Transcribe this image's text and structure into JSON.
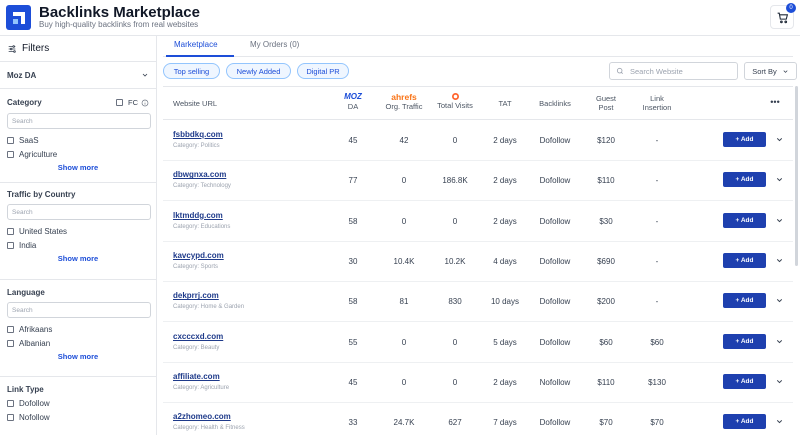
{
  "header": {
    "title": "Backlinks Marketplace",
    "subtitle": "Buy high-quality backlinks from real websites",
    "cart_count": "0"
  },
  "sidebar": {
    "title": "Filters",
    "moz_da": "Moz DA",
    "category": {
      "title": "Category",
      "fc_label": "FC",
      "search_placeholder": "Search",
      "options": [
        "SaaS",
        "Agriculture"
      ],
      "show_more": "Show more"
    },
    "traffic": {
      "title": "Traffic by Country",
      "search_placeholder": "Search",
      "options": [
        "United States",
        "India"
      ],
      "show_more": "Show more"
    },
    "language": {
      "title": "Language",
      "search_placeholder": "Search",
      "options": [
        "Afrikaans",
        "Albanian"
      ],
      "show_more": "Show more"
    },
    "link_type": {
      "title": "Link Type",
      "options": [
        "Dofollow",
        "Nofollow"
      ]
    }
  },
  "tabs": {
    "marketplace": "Marketplace",
    "orders": "My Orders (0)"
  },
  "chips": [
    "Top selling",
    "Newly Added",
    "Digital PR"
  ],
  "search_placeholder": "Search Website",
  "sort_label": "Sort By",
  "columns": {
    "website_url": "Website URL",
    "moz_logo": "MOZ",
    "da": "DA",
    "ahrefs_logo": "ahrefs",
    "org_traffic": "Org. Traffic",
    "total_visits": "Total Visits",
    "tat": "TAT",
    "backlinks": "Backlinks",
    "guest_post": "Guest Post",
    "link_insertion": "Link Insertion",
    "more": "•••"
  },
  "add_label": "+ Add",
  "rows": [
    {
      "site": "fsbbdkq.com",
      "category": "Category: Politics",
      "da": "45",
      "traffic": "42",
      "visits": "0",
      "tat": "2 days",
      "backlinks": "Dofollow",
      "guest": "$120",
      "insertion": "-"
    },
    {
      "site": "dbwgnxa.com",
      "category": "Category: Technology",
      "da": "77",
      "traffic": "0",
      "visits": "186.8K",
      "tat": "2 days",
      "backlinks": "Dofollow",
      "guest": "$110",
      "insertion": "-"
    },
    {
      "site": "lktmddg.com",
      "category": "Category: Educations",
      "da": "58",
      "traffic": "0",
      "visits": "0",
      "tat": "2 days",
      "backlinks": "Dofollow",
      "guest": "$30",
      "insertion": "-"
    },
    {
      "site": "kavcypd.com",
      "category": "Category: Sports",
      "da": "30",
      "traffic": "10.4K",
      "visits": "10.2K",
      "tat": "4 days",
      "backlinks": "Dofollow",
      "guest": "$690",
      "insertion": "-"
    },
    {
      "site": "dekprrj.com",
      "category": "Category: Home & Garden",
      "da": "58",
      "traffic": "81",
      "visits": "830",
      "tat": "10 days",
      "backlinks": "Dofollow",
      "guest": "$200",
      "insertion": "-"
    },
    {
      "site": "cxcccxd.com",
      "category": "Category: Beauty",
      "da": "55",
      "traffic": "0",
      "visits": "0",
      "tat": "5 days",
      "backlinks": "Dofollow",
      "guest": "$60",
      "insertion": "$60"
    },
    {
      "site": "affiliate.com",
      "category": "Category: Agriculture",
      "da": "45",
      "traffic": "0",
      "visits": "0",
      "tat": "2 days",
      "backlinks": "Nofollow",
      "guest": "$110",
      "insertion": "$130"
    },
    {
      "site": "a2zhomeo.com",
      "category": "Category: Health & Fitness",
      "da": "33",
      "traffic": "24.7K",
      "visits": "627",
      "tat": "7 days",
      "backlinks": "Dofollow",
      "guest": "$70",
      "insertion": "$70"
    }
  ],
  "colors": {
    "accent": "#1d4ed8",
    "add_button": "#1e40af"
  }
}
